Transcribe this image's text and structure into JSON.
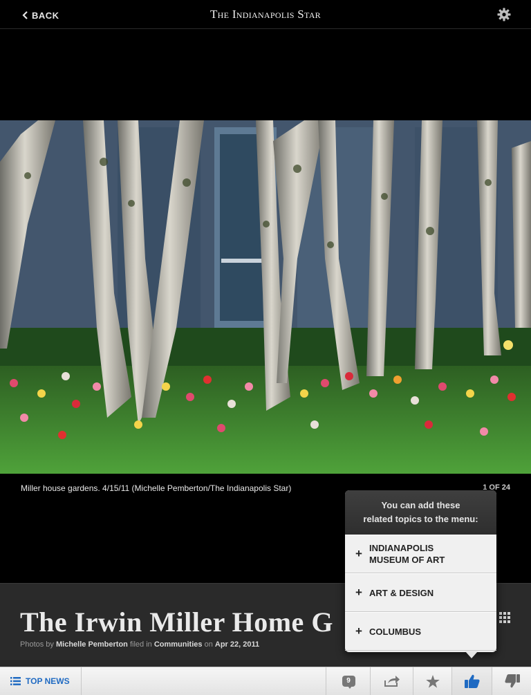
{
  "topbar": {
    "back_label": "BACK",
    "brand": "The Indianapolis Star"
  },
  "photo": {
    "caption": "Miller house gardens. 4/15/11 (Michelle Pemberton/The Indianapolis Star)",
    "counter": "1 OF 24"
  },
  "article": {
    "headline": "The Irwin Miller Home G",
    "byline": {
      "prefix": "Photos by",
      "author": "Michelle Pemberton",
      "filed": "filed in",
      "section": "Communities",
      "on": "on",
      "date": "Apr 22, 2011"
    }
  },
  "popover": {
    "title": "You can add these\nrelated topics to the menu:",
    "items": [
      {
        "label": "INDIANAPOLIS\nMUSEUM OF ART"
      },
      {
        "label": "ART & DESIGN"
      },
      {
        "label": "COLUMBUS"
      }
    ]
  },
  "toolbar": {
    "top_news_label": "TOP NEWS",
    "comment_count": "9"
  },
  "colors": {
    "accent": "#1f6ac2",
    "toolbar_bg": "#ededed",
    "header_bg": "#2a2a2a"
  }
}
